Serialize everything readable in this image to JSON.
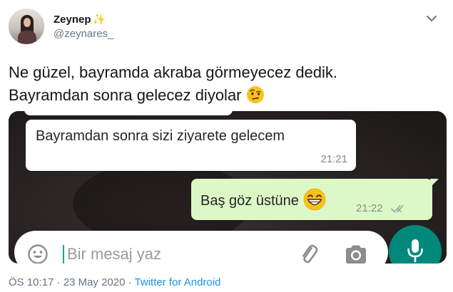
{
  "author": {
    "display_name": "Zeynep",
    "handle": "@zeynares_",
    "name_emoji": "✨"
  },
  "tweet": {
    "line1": "Ne güzel, bayramda akraba görmeyecez dedik.",
    "line2": "Bayramdan sonra gelecez diyolar"
  },
  "chat": {
    "incoming": {
      "text": "Bayramdan sonra sizi ziyarete gelecem",
      "time": "21:21"
    },
    "outgoing": {
      "text": "Baş göz üstüne",
      "time": "21:22",
      "status": "read"
    },
    "composer": {
      "placeholder": "Bir mesaj yaz"
    }
  },
  "meta": {
    "time": "ÖS 10:17",
    "date": "23 May 2020",
    "separator": "·",
    "source": "Twitter for Android"
  },
  "colors": {
    "twitter_blue": "#1b95e0",
    "whatsapp_green": "#00897b",
    "outgoing_bubble": "#dcf8c6"
  },
  "icons": [
    "chevron-down-icon",
    "raised-eyebrow-emoji",
    "grinning-emoji",
    "double-check-icon",
    "smiley-icon",
    "paperclip-icon",
    "camera-icon",
    "microphone-icon"
  ]
}
